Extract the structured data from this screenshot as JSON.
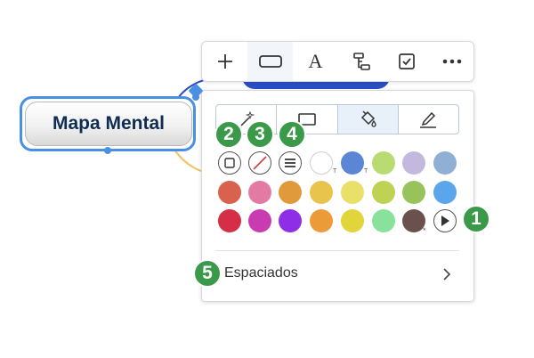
{
  "node": {
    "title": "Mapa Mental"
  },
  "toolbar": {
    "items": [
      {
        "name": "add",
        "icon": "plus-icon"
      },
      {
        "name": "shape",
        "icon": "rectangle-icon",
        "active": true
      },
      {
        "name": "text",
        "icon": "text-format-icon",
        "label": "A"
      },
      {
        "name": "structure",
        "icon": "structure-icon"
      },
      {
        "name": "task",
        "icon": "checkbox-icon"
      },
      {
        "name": "more",
        "icon": "more-icon"
      }
    ]
  },
  "panel": {
    "tabs": [
      {
        "name": "style",
        "icon": "magic-wand-icon"
      },
      {
        "name": "shape",
        "icon": "rectangle-icon"
      },
      {
        "name": "fill",
        "icon": "paint-bucket-icon",
        "active": true
      },
      {
        "name": "border",
        "icon": "pen-icon"
      }
    ],
    "tools": [
      {
        "name": "border-style",
        "icon": "square-outline-icon"
      },
      {
        "name": "no-fill",
        "icon": "no-color-icon"
      },
      {
        "name": "line-style",
        "icon": "lines-icon"
      }
    ],
    "swatch_marks": {
      "t1": "T",
      "t2": "T",
      "star": "*"
    },
    "colors": {
      "row1": [
        "#ffffff",
        "#5b86d6",
        "#b8dc72",
        "#c3b8dd",
        "#8fb0d4"
      ],
      "row2": [
        "#d9614d",
        "#e37aa3",
        "#e09a3c",
        "#e9c44c",
        "#e9e06a",
        "#bfd253",
        "#98c25a",
        "#5aa6ea"
      ],
      "row3": [
        "#d52e47",
        "#c83bb1",
        "#8e2ee6",
        "#eb9b37",
        "#e2d43b",
        "#88e29b",
        "#6b514e"
      ]
    },
    "spacing_label": "Espaciados"
  },
  "badges": [
    "1",
    "2",
    "3",
    "4",
    "5"
  ],
  "accent_color": "#4a90e2",
  "badge_color": "#3a9a4a"
}
